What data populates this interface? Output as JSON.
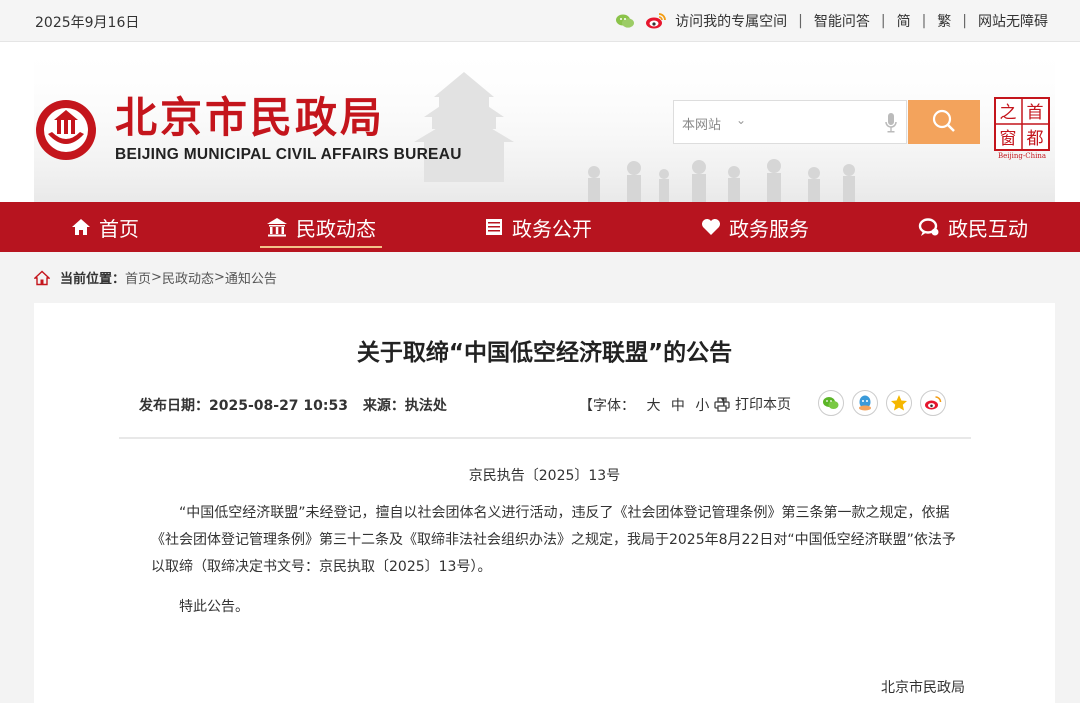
{
  "topbar": {
    "date": "2025年9月16日",
    "links": [
      "访问我的专属空间",
      "智能问答",
      "简",
      "繁",
      "网站无障碍"
    ],
    "icons": [
      "wechat-icon",
      "weibo-icon"
    ]
  },
  "header": {
    "site_name_cn": "北京市民政局",
    "site_name_en": "BEIJING MUNICIPAL CIVIL AFFAIRS BUREAU",
    "search_scope": "本网站",
    "search_placeholder": "",
    "capital_logo_chars": [
      "首",
      "都",
      "之",
      "窗"
    ],
    "capital_logo_en": "Beijing-China"
  },
  "nav": {
    "items": [
      {
        "label": "首页",
        "icon": "home-icon"
      },
      {
        "label": "民政动态",
        "icon": "temple-icon",
        "active": true
      },
      {
        "label": "政务公开",
        "icon": "document-icon"
      },
      {
        "label": "政务服务",
        "icon": "heart-icon"
      },
      {
        "label": "政民互动",
        "icon": "chat-icon"
      }
    ]
  },
  "breadcrumb": {
    "prefix": "当前位置：",
    "items": [
      "首页",
      "民政动态",
      "通知公告"
    ],
    "separator": ">"
  },
  "article": {
    "title": "关于取缔“中国低空经济联盟”的公告",
    "publish_label": "发布日期：",
    "publish_date": "2025-08-27 10:53",
    "source_label": "来源：",
    "source": "执法处",
    "font_label": "【字体：",
    "font_sizes": [
      "大",
      "中",
      "小"
    ],
    "font_close": "】",
    "print_label": "打印本页",
    "doc_number": "京民执告〔2025〕13号",
    "body": "“中国低空经济联盟”未经登记，擅自以社会团体名义进行活动，违反了《社会团体登记管理条例》第三条第一款之规定，依据《社会团体登记管理条例》第三十二条及《取缔非法社会组织办法》之规定，我局于2025年8月22日对“中国低空经济联盟”依法予以取缔（取缔决定书文号：京民执取〔2025〕13号）。",
    "closing": "特此公告。",
    "signature": "北京市民政局",
    "share_icons": [
      "wechat-icon",
      "qq-icon",
      "qzone-icon",
      "weibo-icon"
    ]
  },
  "colors": {
    "brand_red": "#b7141f",
    "logo_red": "#c4151c",
    "search_orange": "#f3a35c",
    "nav_underline": "#f3c28a"
  }
}
